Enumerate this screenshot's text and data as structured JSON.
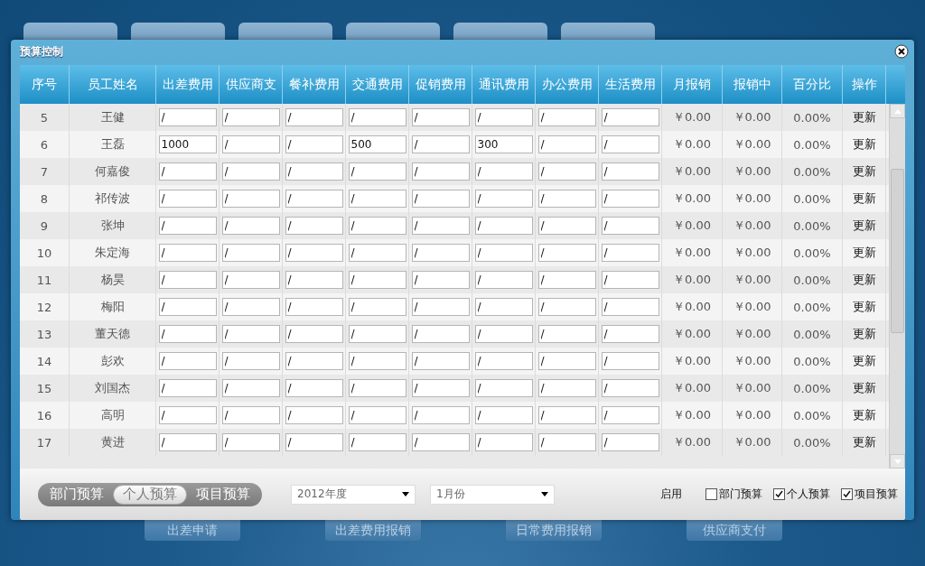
{
  "dialog": {
    "title": "预算控制"
  },
  "table": {
    "columns": [
      "序号",
      "员工姓名",
      "出差费用",
      "供应商支",
      "餐补费用",
      "交通费用",
      "促销费用",
      "通讯费用",
      "办公费用",
      "生活费用",
      "月报销",
      "报销中",
      "百分比",
      "操作"
    ],
    "rows": [
      {
        "no": "5",
        "name": "王健",
        "amounts": [
          "/",
          "/",
          "/",
          "/",
          "/",
          "/",
          "/",
          "/"
        ],
        "monthly": "￥0.00",
        "pending": "￥0.00",
        "percent": "0.00%",
        "action": "更新"
      },
      {
        "no": "6",
        "name": "王磊",
        "amounts": [
          "1000",
          "/",
          "/",
          "500",
          "/",
          "300",
          "/",
          "/"
        ],
        "monthly": "￥0.00",
        "pending": "￥0.00",
        "percent": "0.00%",
        "action": "更新"
      },
      {
        "no": "7",
        "name": "何嘉俊",
        "amounts": [
          "/",
          "/",
          "/",
          "/",
          "/",
          "/",
          "/",
          "/"
        ],
        "monthly": "￥0.00",
        "pending": "￥0.00",
        "percent": "0.00%",
        "action": "更新"
      },
      {
        "no": "8",
        "name": "祁传波",
        "amounts": [
          "/",
          "/",
          "/",
          "/",
          "/",
          "/",
          "/",
          "/"
        ],
        "monthly": "￥0.00",
        "pending": "￥0.00",
        "percent": "0.00%",
        "action": "更新"
      },
      {
        "no": "9",
        "name": "张坤",
        "amounts": [
          "/",
          "/",
          "/",
          "/",
          "/",
          "/",
          "/",
          "/"
        ],
        "monthly": "￥0.00",
        "pending": "￥0.00",
        "percent": "0.00%",
        "action": "更新"
      },
      {
        "no": "10",
        "name": "朱定海",
        "amounts": [
          "/",
          "/",
          "/",
          "/",
          "/",
          "/",
          "/",
          "/"
        ],
        "monthly": "￥0.00",
        "pending": "￥0.00",
        "percent": "0.00%",
        "action": "更新"
      },
      {
        "no": "11",
        "name": "杨昊",
        "amounts": [
          "/",
          "/",
          "/",
          "/",
          "/",
          "/",
          "/",
          "/"
        ],
        "monthly": "￥0.00",
        "pending": "￥0.00",
        "percent": "0.00%",
        "action": "更新"
      },
      {
        "no": "12",
        "name": "梅阳",
        "amounts": [
          "/",
          "/",
          "/",
          "/",
          "/",
          "/",
          "/",
          "/"
        ],
        "monthly": "￥0.00",
        "pending": "￥0.00",
        "percent": "0.00%",
        "action": "更新"
      },
      {
        "no": "13",
        "name": "董天德",
        "amounts": [
          "/",
          "/",
          "/",
          "/",
          "/",
          "/",
          "/",
          "/"
        ],
        "monthly": "￥0.00",
        "pending": "￥0.00",
        "percent": "0.00%",
        "action": "更新"
      },
      {
        "no": "14",
        "name": "彭欢",
        "amounts": [
          "/",
          "/",
          "/",
          "/",
          "/",
          "/",
          "/",
          "/"
        ],
        "monthly": "￥0.00",
        "pending": "￥0.00",
        "percent": "0.00%",
        "action": "更新"
      },
      {
        "no": "15",
        "name": "刘国杰",
        "amounts": [
          "/",
          "/",
          "/",
          "/",
          "/",
          "/",
          "/",
          "/"
        ],
        "monthly": "￥0.00",
        "pending": "￥0.00",
        "percent": "0.00%",
        "action": "更新"
      },
      {
        "no": "16",
        "name": "高明",
        "amounts": [
          "/",
          "/",
          "/",
          "/",
          "/",
          "/",
          "/",
          "/"
        ],
        "monthly": "￥0.00",
        "pending": "￥0.00",
        "percent": "0.00%",
        "action": "更新"
      },
      {
        "no": "17",
        "name": "黄进",
        "amounts": [
          "/",
          "/",
          "/",
          "/",
          "/",
          "/",
          "/",
          "/"
        ],
        "monthly": "￥0.00",
        "pending": "￥0.00",
        "percent": "0.00%",
        "action": "更新"
      }
    ]
  },
  "footer": {
    "segments": [
      {
        "label": "部门预算",
        "selected": false
      },
      {
        "label": "个人预算",
        "selected": true
      },
      {
        "label": "项目预算",
        "selected": false
      }
    ],
    "year_select": {
      "value": "2012年度"
    },
    "month_select": {
      "value": "1月份"
    },
    "enable_label": "启用",
    "checkboxes": [
      {
        "label": "部门预算",
        "checked": false
      },
      {
        "label": "个人预算",
        "checked": true
      },
      {
        "label": "项目预算",
        "checked": true
      }
    ]
  },
  "background_buttons": [
    "出差申请",
    "出差费用报销",
    "日常费用报销",
    "供应商支付"
  ]
}
